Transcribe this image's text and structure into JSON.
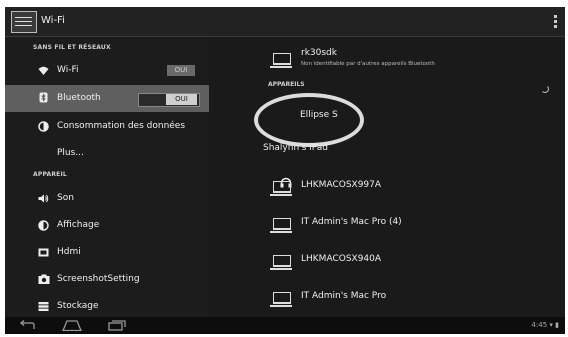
{
  "actionbar": {
    "title": "Wi-Fi",
    "app_icon": "settings-sliders-icon",
    "overflow_icon": "overflow-menu-icon"
  },
  "left": {
    "section_wireless": "SANS FIL ET RÉSEAUX",
    "wifi": {
      "label": "Wi-Fi",
      "toggle": "OUI",
      "icon": "wifi-icon"
    },
    "bluetooth": {
      "label": "Bluetooth",
      "toggle": "OUI",
      "icon": "bluetooth-icon"
    },
    "data_usage": {
      "label": "Consommation des données",
      "icon": "data-usage-icon"
    },
    "more": {
      "label": "Plus..."
    },
    "section_device": "APPAREIL",
    "sound": {
      "label": "Son",
      "icon": "sound-icon"
    },
    "display": {
      "label": "Affichage",
      "icon": "display-icon"
    },
    "hdmi": {
      "label": "Hdmi",
      "icon": "hdmi-icon"
    },
    "screenshot": {
      "label": "ScreenshotSetting",
      "icon": "camera-icon"
    },
    "storage": {
      "label": "Stockage",
      "icon": "storage-icon"
    }
  },
  "right": {
    "own_device": {
      "name": "rk30sdk",
      "subtitle": "Non identifiable par d'autres appareils Bluetooth"
    },
    "section_devices": "APPAREILS",
    "devices": [
      {
        "name": "Ellipse S",
        "icon": "headphones-icon"
      },
      {
        "name": "Shalynn's iPad"
      },
      {
        "name": "LHKMACOSX997A",
        "icon": "laptop-icon"
      },
      {
        "name": "IT Admin's Mac Pro (4)",
        "icon": "laptop-icon"
      },
      {
        "name": "LHKMACOSX940A",
        "icon": "laptop-icon"
      },
      {
        "name": "IT Admin's Mac Pro",
        "icon": "laptop-icon"
      }
    ]
  },
  "navbar": {
    "back_icon": "back-icon",
    "home_icon": "home-icon",
    "recents_icon": "recents-icon",
    "time": "4:45"
  },
  "colors": {
    "selected_row": "#5f5f5f",
    "toggle_on": "#cfcfcf",
    "background": "#1a1a1a",
    "highlight_ring": "#dcdcdc"
  }
}
